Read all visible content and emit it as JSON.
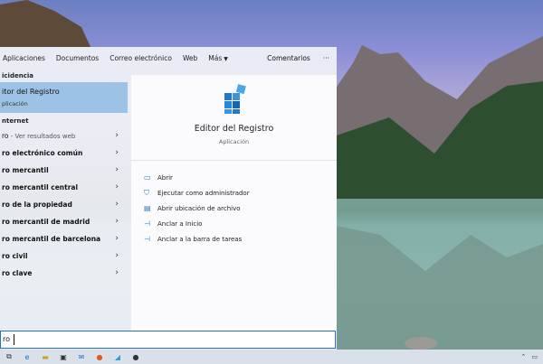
{
  "search_panel": {
    "tabs": [
      "Aplicaciones",
      "Documentos",
      "Correo electrónico",
      "Web",
      "Más"
    ],
    "more_caret_icon": "chevron-down-icon",
    "feedback_label": "Comentarios",
    "overflow_label": "···",
    "best_match_header": "icidencia",
    "best_match": {
      "title": "itor del Registro",
      "subtitle": "plicación"
    },
    "web_header": "nternet",
    "web_results": [
      {
        "bold": "ro",
        "rest": " - Ver resultados web"
      },
      {
        "bold": "ro electrónico común",
        "rest": ""
      },
      {
        "bold": "ro mercantil",
        "rest": ""
      },
      {
        "bold": "ro mercantil central",
        "rest": ""
      },
      {
        "bold": "ro de la propiedad",
        "rest": ""
      },
      {
        "bold": "ro mercantil de madrid",
        "rest": ""
      },
      {
        "bold": "ro mercantil de barcelona",
        "rest": ""
      },
      {
        "bold": "ro civil",
        "rest": ""
      },
      {
        "bold": "ro clave",
        "rest": ""
      }
    ]
  },
  "detail_pane": {
    "app_title": "Editor del Registro",
    "app_type": "Aplicación",
    "actions": [
      {
        "label": "Abrir",
        "icon": "open-icon"
      },
      {
        "label": "Ejecutar como administrador",
        "icon": "run-as-admin-icon"
      },
      {
        "label": "Abrir ubicación de archivo",
        "icon": "file-location-icon"
      },
      {
        "label": "Anclar a Inicio",
        "icon": "pin-icon"
      },
      {
        "label": "Anclar a la barra de tareas",
        "icon": "pin-icon"
      }
    ]
  },
  "search_box": {
    "value": "ro"
  },
  "colors": {
    "accent": "#2b6fbf",
    "selected_bg": "#9cc3e6"
  }
}
